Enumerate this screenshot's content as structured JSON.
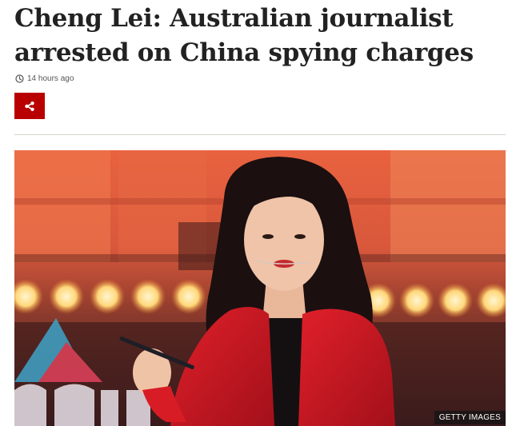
{
  "article": {
    "headline": "Cheng Lei: Australian journalist arrested on China spying charges",
    "timestamp": "14 hours ago",
    "clock_icon": "clock-icon",
    "share_icon": "share-icon",
    "share_button_color": "#b80000",
    "image": {
      "credit": "GETTY IMAGES",
      "depicts": "woman in red blazer speaking on stage"
    }
  }
}
